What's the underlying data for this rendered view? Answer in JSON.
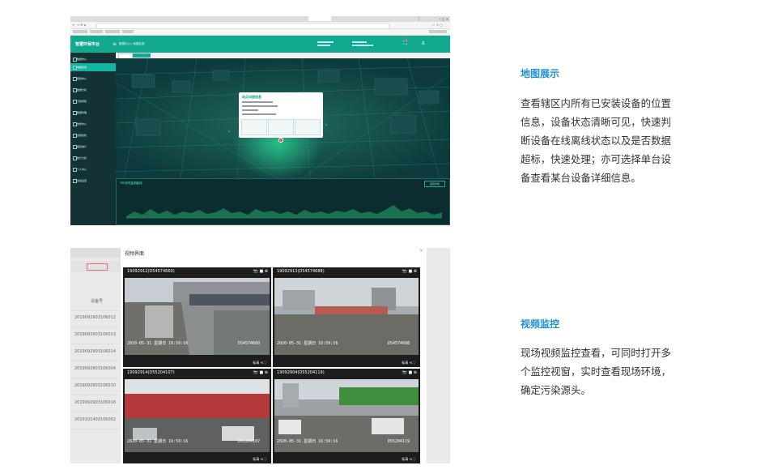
{
  "map_section": {
    "heading": "地图展示",
    "lines": [
      "查看辖区内所有已安装设备的位置",
      "信息，设备状态清晰可见，快速判",
      "断设备在线离线状态以及是否数据",
      "超标，快速处理；亦可选择单台设",
      "备查看某台设备详细信息。"
    ]
  },
  "video_section": {
    "heading": "视频监控",
    "lines": [
      "现场视频监控查看，可同时打开多",
      "个监控视窗，实时查看现场环境，",
      "确定污染源头。"
    ]
  },
  "map_shot": {
    "app_title": "智慧环保平台",
    "breadcrumb": "数据中心 / 地图监测",
    "sidebar": [
      "数据中心",
      "地图监测",
      "视频中心",
      "数据分析",
      "污染预警",
      "数据管理",
      "告警中心",
      "运维巡检",
      "报表统计",
      "统计分析",
      "个人中心",
      "系统设置"
    ],
    "popup_title": "站点详细信息",
    "chart_title": "TSP实时监测曲线",
    "chart_button": "返回详情"
  },
  "video_shot": {
    "dialog_title": "视频界面",
    "device_header": "设备号",
    "device_ids": [
      "2019092903106012",
      "2019092903106013",
      "2019092903106014",
      "2019092903106004",
      "2019092903106010",
      "2019092903106016",
      "2019101403106002"
    ],
    "cameras": [
      {
        "title": "19092912(D54574660)",
        "osd_date": "2020-05-31 星期日 16:59:16",
        "osd_id": "D54574660"
      },
      {
        "title": "19092913(D54574688)",
        "osd_date": "2020-05-31 星期日 16:59:16",
        "osd_id": "D54574688"
      },
      {
        "title": "19092914(D55204107)",
        "osd_date": "2020-05-31 星期日 16:59:16",
        "osd_id": "D55204107"
      },
      {
        "title": "19092904(D55204119)",
        "osd_date": "2020-05-31 星期日 16:59:16",
        "osd_id": "D55204119"
      }
    ],
    "card_footer": "标清"
  }
}
